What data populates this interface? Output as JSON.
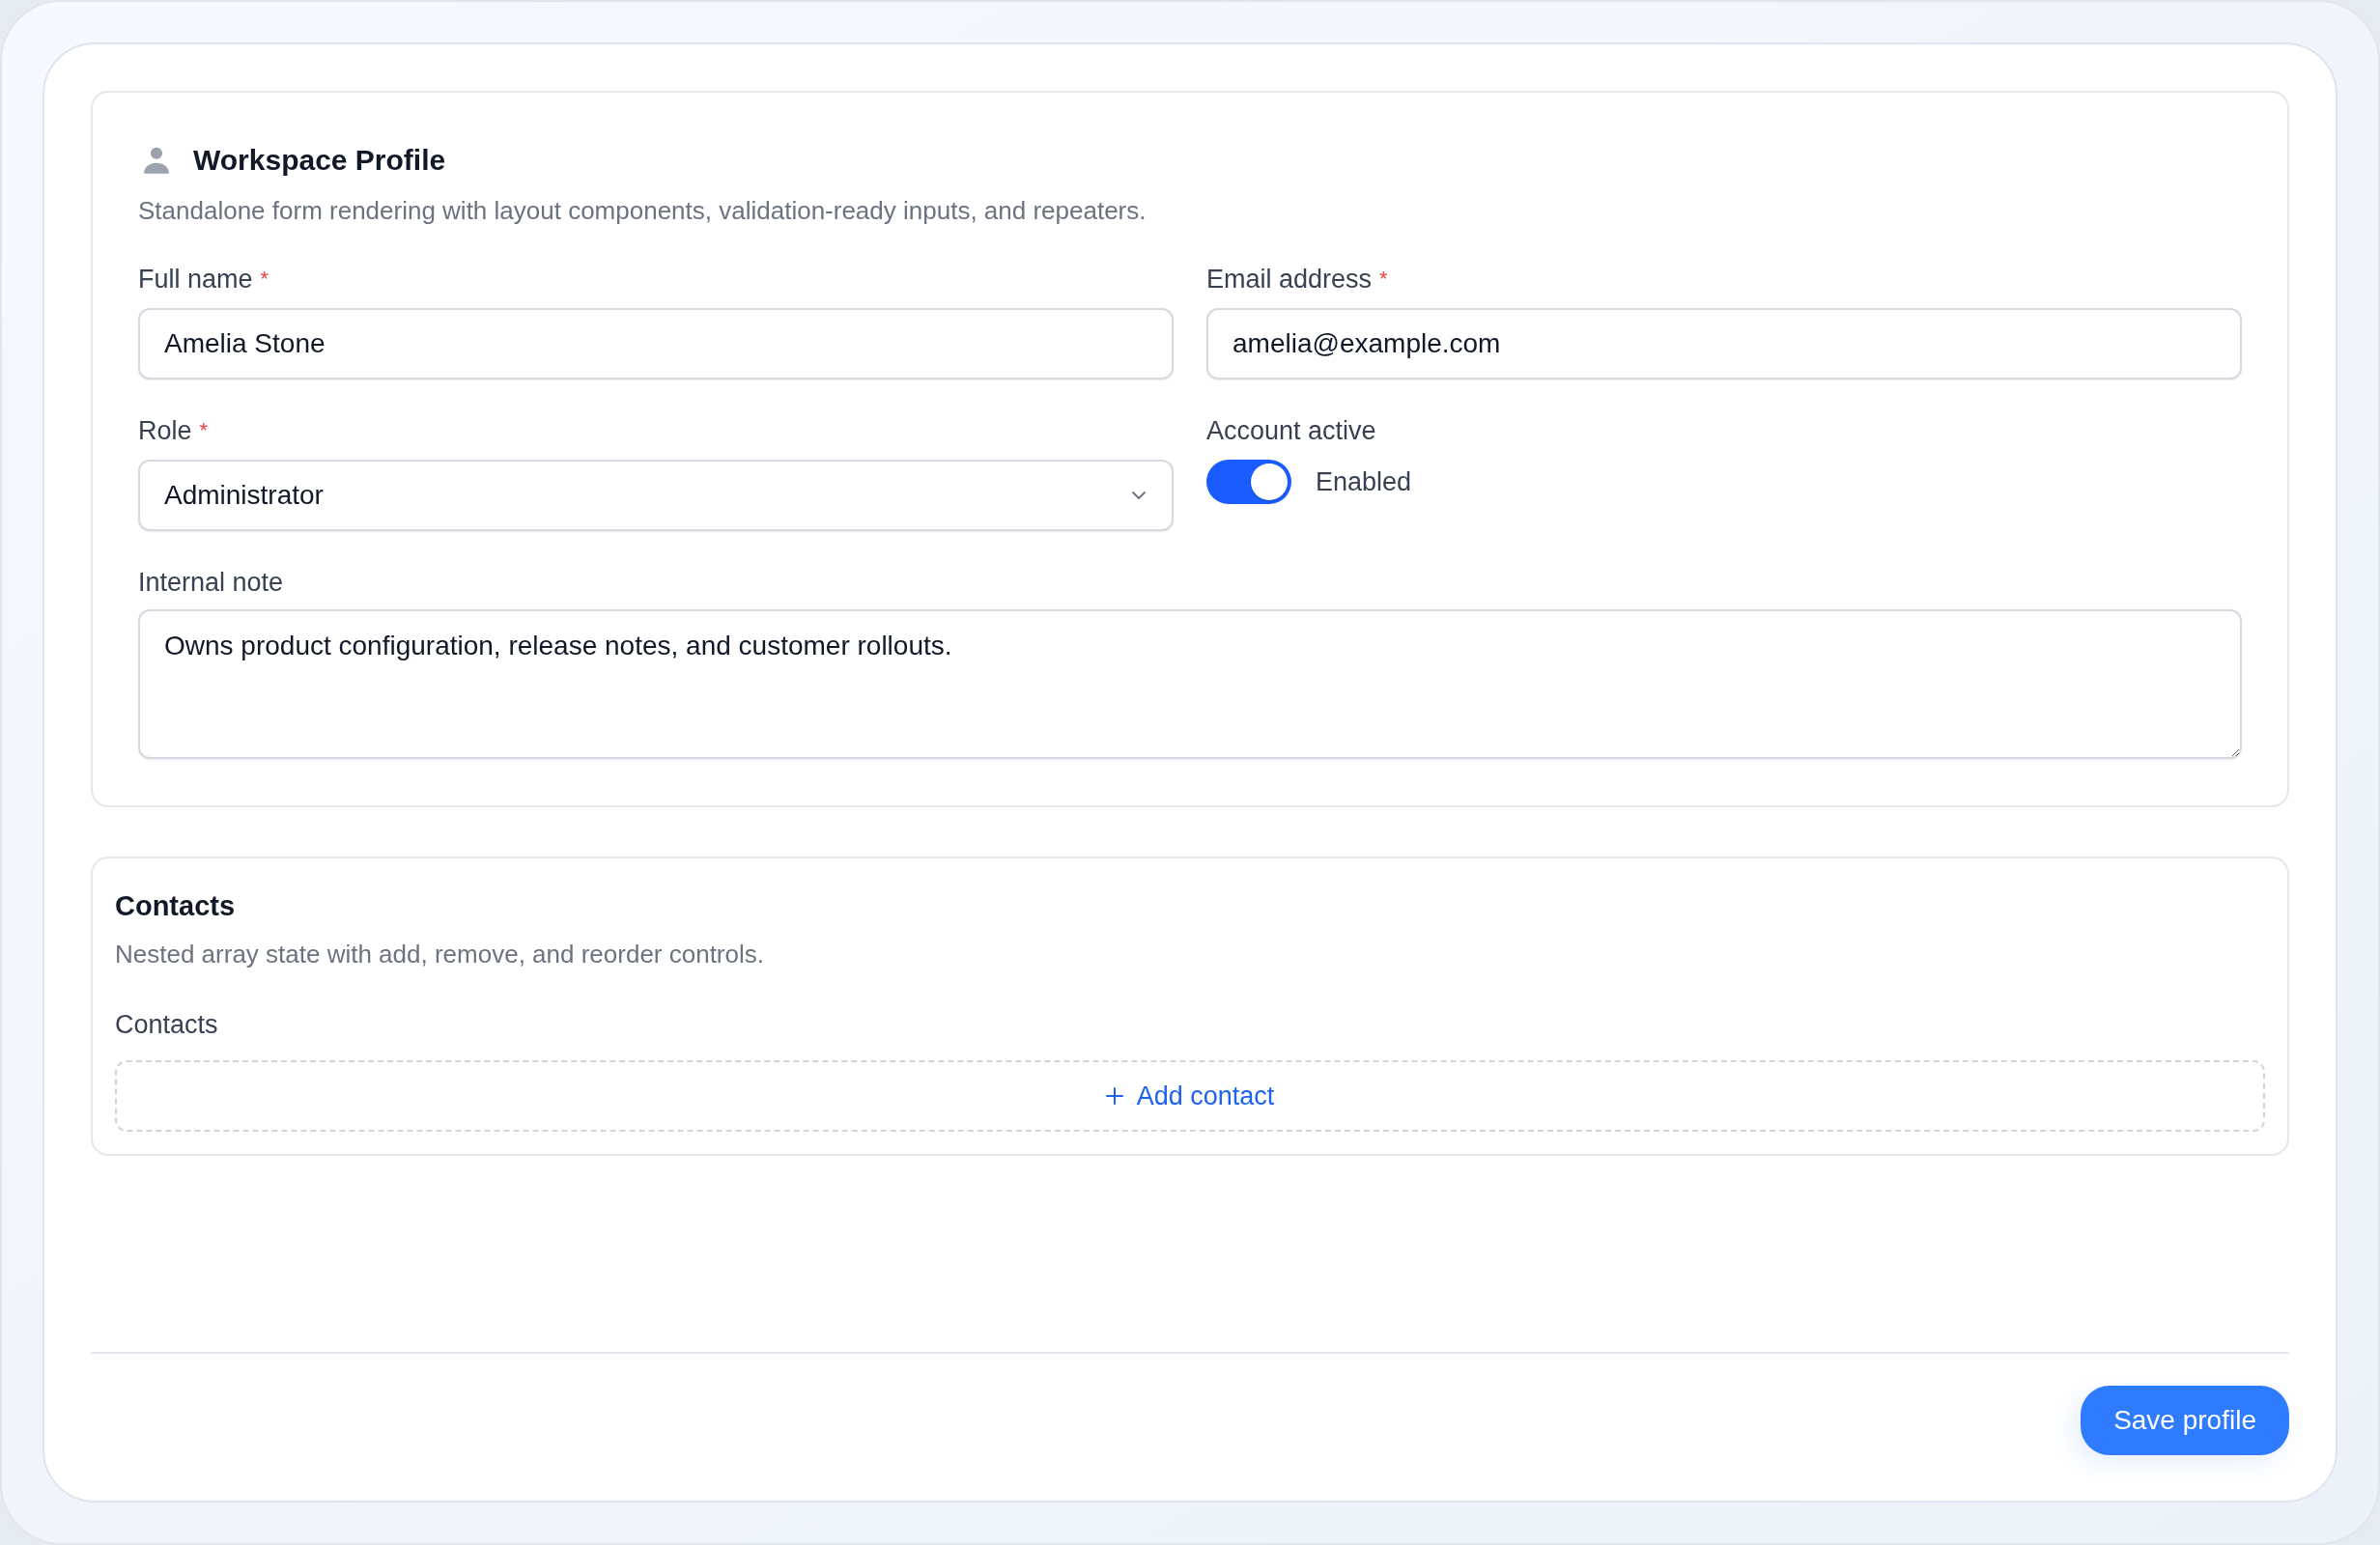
{
  "form": {
    "title": "Workspace Profile",
    "description": "Standalone form rendering with layout components, validation-ready inputs, and repeaters.",
    "fields": [
      {
        "kind": "text",
        "label": "Full name",
        "required_mark": "*",
        "value": "Amelia Stone"
      },
      {
        "kind": "text",
        "label": "Email address",
        "required_mark": "*",
        "value": "amelia@example.com"
      },
      {
        "kind": "select",
        "label": "Role",
        "required_mark": "*",
        "value": "Administrator"
      },
      {
        "kind": "toggle",
        "label": "Account active",
        "on": true,
        "state_label": "Enabled"
      },
      {
        "kind": "textarea",
        "label": "Internal note",
        "value": "Owns product configuration, release notes, and customer rollouts."
      }
    ]
  },
  "contacts_section": {
    "title": "Contacts",
    "description": "Nested array state with add, remove, and reorder controls.",
    "field_label": "Contacts",
    "add_button": "Add contact"
  },
  "footer": {
    "save_button": "Save profile"
  }
}
